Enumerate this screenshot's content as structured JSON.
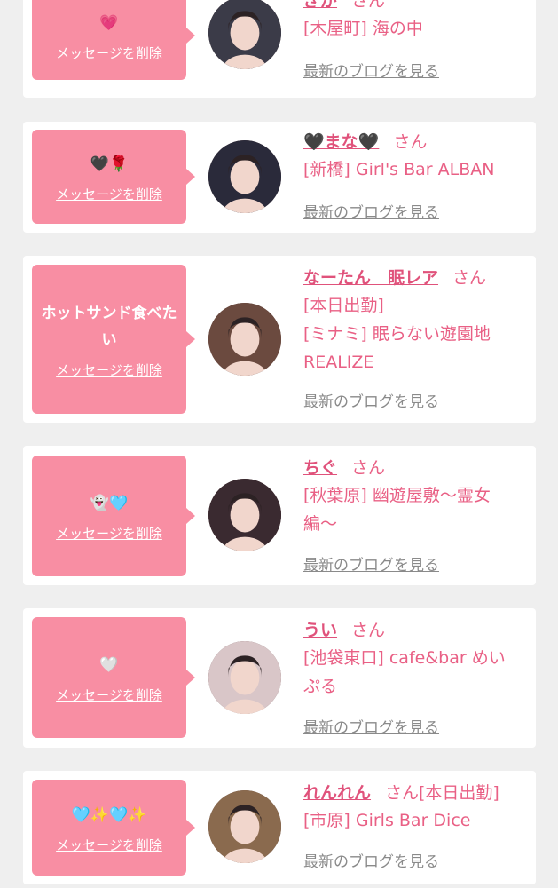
{
  "items": [
    {
      "message": "💗",
      "delete_label": "メッセージを削除",
      "name": "ぎが",
      "suffix": "さん",
      "lines": [
        "[木屋町] 海の中"
      ],
      "blog_link": "最新のブログを見る",
      "avatar_tone": "#3b3b48"
    },
    {
      "message": "🖤🌹",
      "delete_label": "メッセージを削除",
      "name": "🖤まな🖤",
      "suffix": "さん",
      "lines": [
        "[新橋] Girl's Bar ALBAN"
      ],
      "blog_link": "最新のブログを見る",
      "avatar_tone": "#2a2a3a"
    },
    {
      "message": "ホットサンド食べたい",
      "delete_label": "メッセージを削除",
      "name": "なーたん　眠レア",
      "suffix": "さん",
      "lines": [
        "[本日出勤]",
        "[ミナミ] 眠らない遊園地",
        "REALIZE"
      ],
      "blog_link": "最新のブログを見る",
      "avatar_tone": "#6b4a3f"
    },
    {
      "message": "👻🩵",
      "delete_label": "メッセージを削除",
      "name": "ちぐ",
      "suffix": "さん",
      "lines": [
        "[秋葉原] 幽遊屋敷〜霊女",
        "編〜"
      ],
      "blog_link": "最新のブログを見る",
      "avatar_tone": "#3a2a30"
    },
    {
      "message": "🤍",
      "delete_label": "メッセージを削除",
      "name": "うい",
      "suffix": "さん",
      "lines": [
        "[池袋東口] cafe&bar めい",
        "ぷる"
      ],
      "blog_link": "最新のブログを見る",
      "avatar_tone": "#d9c6c8"
    },
    {
      "message": "🩵✨🩵✨",
      "delete_label": "メッセージを削除",
      "name": "れんれん",
      "suffix": "さん[本日出勤]",
      "lines": [
        "[市原] Girls Bar Dice"
      ],
      "blog_link": "最新のブログを見る",
      "avatar_tone": "#8a6a4e"
    }
  ],
  "colors": {
    "accent_pink": "#f88ea3",
    "name_pink": "#e0527b",
    "text_pink": "#e96085",
    "link_gray": "#8a8a8a",
    "background": "#efefef"
  }
}
